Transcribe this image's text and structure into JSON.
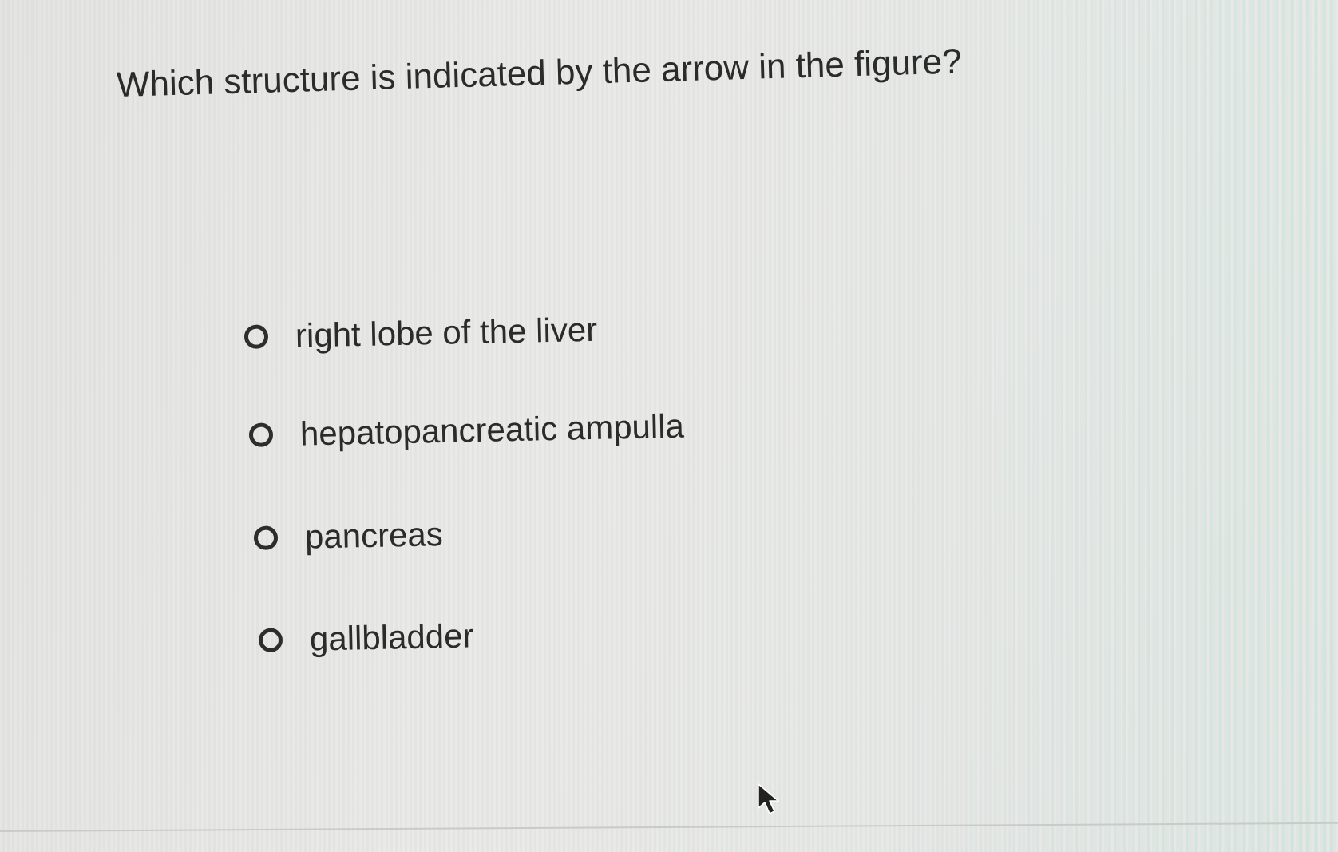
{
  "question": {
    "text": "Which structure is indicated by the arrow in the figure?"
  },
  "options": [
    {
      "label": "right lobe of the liver",
      "selected": false
    },
    {
      "label": "hepatopancreatic ampulla",
      "selected": false
    },
    {
      "label": "pancreas",
      "selected": false
    },
    {
      "label": "gallbladder",
      "selected": false
    }
  ],
  "icons": {
    "radio": "radio-button-unselected-icon",
    "cursor": "mouse-pointer-icon"
  },
  "colors": {
    "text": "#2b2b2b",
    "radio_border": "#2d2d2d",
    "background": "#e6e6e4"
  }
}
